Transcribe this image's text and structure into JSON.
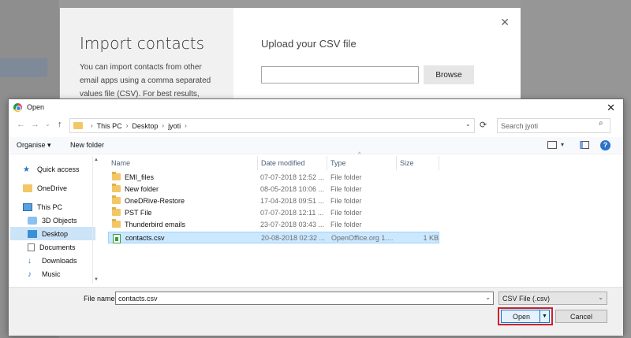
{
  "import_panel": {
    "title": "Import contacts",
    "description": "You can import contacts from other email apps using a comma separated values file (CSV). For best results,",
    "upload_title": "Upload your CSV file",
    "browse_label": "Browse",
    "close_glyph": "✕"
  },
  "dialog": {
    "title": "Open",
    "close_glyph": "✕",
    "nav": {
      "back": "←",
      "forward": "→",
      "recent": "⌄",
      "up": "↑",
      "refresh": "⟳"
    },
    "breadcrumb": [
      "This PC",
      "Desktop",
      "jyoti"
    ],
    "crumb_sep": "›",
    "search_placeholder": "Search jyoti",
    "toolbar": {
      "organise": "Organise ▾",
      "new_folder": "New folder",
      "help": "?"
    },
    "nav_items": [
      {
        "label": "Quick access",
        "icon": "star-icon"
      },
      {
        "label": "OneDrive",
        "icon": "onedrive-icon"
      },
      {
        "label": "This PC",
        "icon": "computer-icon"
      },
      {
        "label": "3D Objects",
        "icon": "3d-objects-icon"
      },
      {
        "label": "Desktop",
        "icon": "desktop-icon",
        "selected": true
      },
      {
        "label": "Documents",
        "icon": "documents-icon"
      },
      {
        "label": "Downloads",
        "icon": "downloads-icon"
      },
      {
        "label": "Music",
        "icon": "music-icon"
      }
    ],
    "columns": {
      "name": "Name",
      "date": "Date modified",
      "type": "Type",
      "size": "Size"
    },
    "files": [
      {
        "name": "EMI_files",
        "date": "07-07-2018 12:52 ...",
        "type": "File folder",
        "size": "",
        "kind": "folder"
      },
      {
        "name": "New folder",
        "date": "08-05-2018 10:06 ...",
        "type": "File folder",
        "size": "",
        "kind": "folder"
      },
      {
        "name": "OneDRive-Restore",
        "date": "17-04-2018 09:51 ...",
        "type": "File folder",
        "size": "",
        "kind": "folder"
      },
      {
        "name": "PST File",
        "date": "07-07-2018 12:11 ...",
        "type": "File folder",
        "size": "",
        "kind": "folder"
      },
      {
        "name": "Thunderbird emails",
        "date": "23-07-2018 03:43 ...",
        "type": "File folder",
        "size": "",
        "kind": "folder"
      },
      {
        "name": "contacts.csv",
        "date": "20-08-2018 02:32 ...",
        "type": "OpenOffice.org 1....",
        "size": "1 KB",
        "kind": "csv",
        "selected": true
      }
    ],
    "file_name_label": "File name:",
    "file_name_value": "contacts.csv",
    "file_type_value": "CSV File (.csv)",
    "open_label": "Open",
    "cancel_label": "Cancel",
    "accent_highlight": "#d0202a"
  }
}
